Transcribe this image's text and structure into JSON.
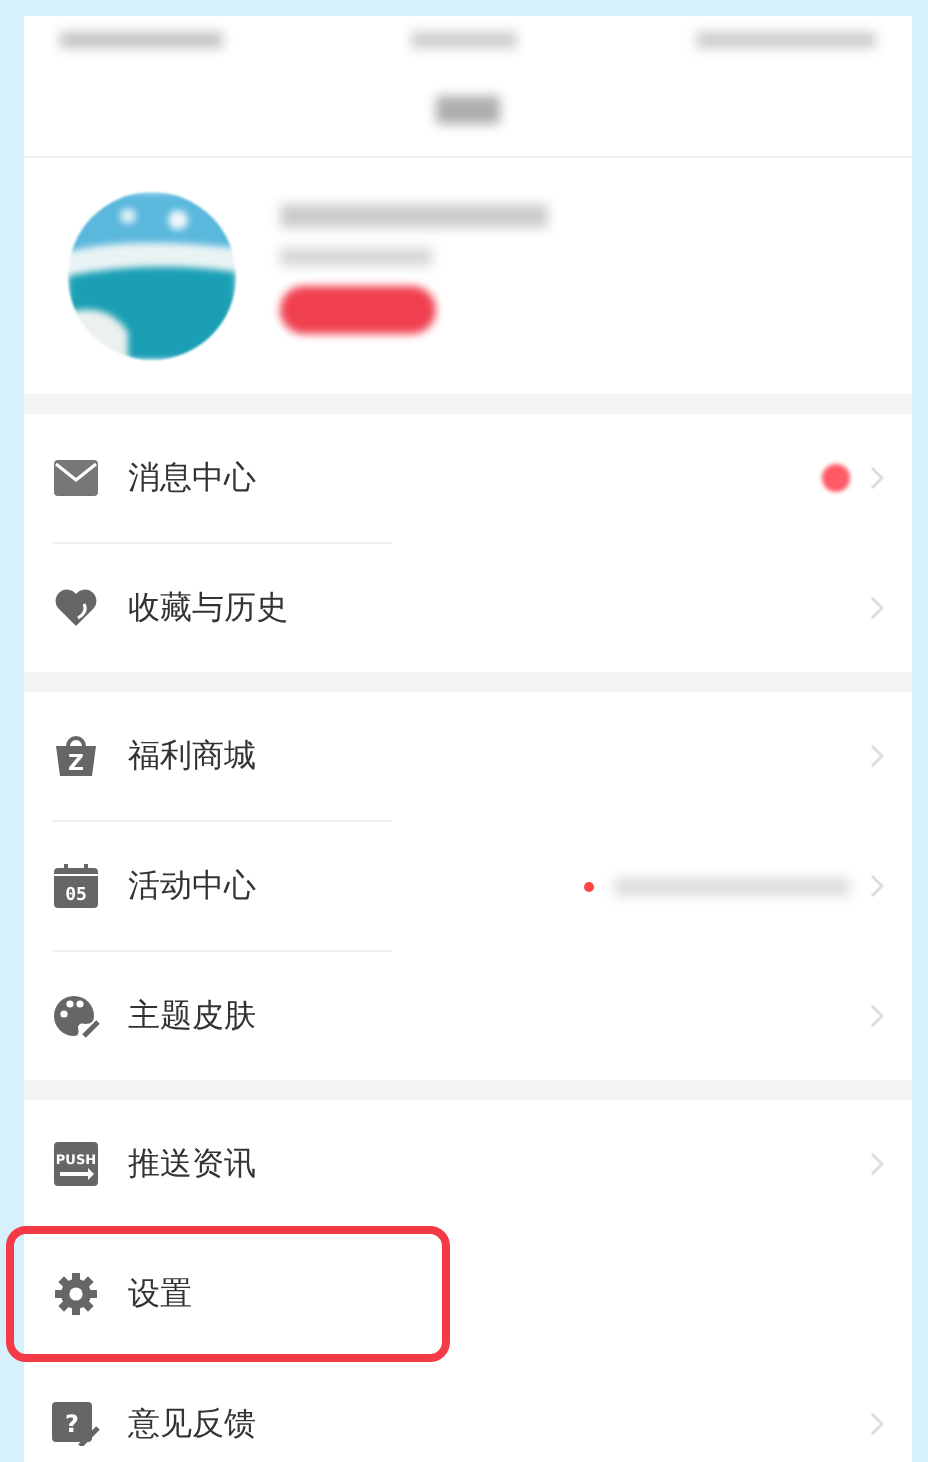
{
  "groups": [
    {
      "items": [
        {
          "label": "消息中心",
          "badge": true,
          "note": false,
          "highlighted": false
        },
        {
          "label": "收藏与历史",
          "badge": false,
          "note": false,
          "highlighted": false
        }
      ]
    },
    {
      "items": [
        {
          "label": "福利商城",
          "badge": false,
          "note": false,
          "highlighted": false,
          "icon_text": "Z"
        },
        {
          "label": "活动中心",
          "badge": false,
          "note": true,
          "highlighted": false,
          "icon_text": "05"
        },
        {
          "label": "主题皮肤",
          "badge": false,
          "note": false,
          "highlighted": false
        }
      ]
    },
    {
      "items": [
        {
          "label": "推送资讯",
          "badge": false,
          "note": false,
          "highlighted": false,
          "icon_text": "PUSH"
        },
        {
          "label": "设置",
          "badge": false,
          "note": false,
          "highlighted": true
        },
        {
          "label": "意见反馈",
          "badge": false,
          "note": false,
          "highlighted": false,
          "icon_text": "?"
        }
      ]
    }
  ]
}
